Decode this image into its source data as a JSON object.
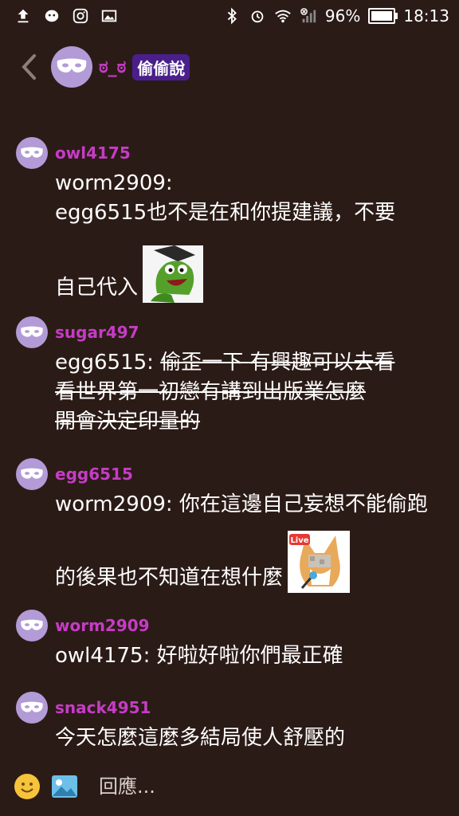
{
  "status_bar": {
    "battery": "96%",
    "time": "18:13"
  },
  "header": {
    "name": "ಠ_ಠ",
    "badge": "偷偷說"
  },
  "messages": [
    {
      "user": "owl4175",
      "line1": "worm2909:",
      "line2": "egg6515也不是在和你提建議，不要",
      "line3": "自己代入",
      "sticker": "kermit-sticker"
    },
    {
      "user": "sugar497",
      "prefix": "egg6515: ",
      "strike1": "偷歪一下 有興趣可以去看",
      "strike2": "看世界第一初戀有講到出版業怎麼",
      "strike3": "開會決定印量的"
    },
    {
      "user": "egg6515",
      "line1": "worm2909: 你在這邊自己妄想不能偷跑",
      "line2": "的後果也不知道在想什麼",
      "sticker": "fox-live-sticker",
      "sticker_label": "Live"
    },
    {
      "user": "worm2909",
      "line1": "owl4175: 好啦好啦你們最正確"
    },
    {
      "user": "snack4951",
      "line1": "今天怎麼這麼多結局使人舒壓的"
    }
  ],
  "input": {
    "placeholder": "回應..."
  },
  "colors": {
    "background": "#2b1b16",
    "username": "#c53cc5",
    "avatar": "#b29bd6",
    "badge": "#4a1f8c"
  }
}
